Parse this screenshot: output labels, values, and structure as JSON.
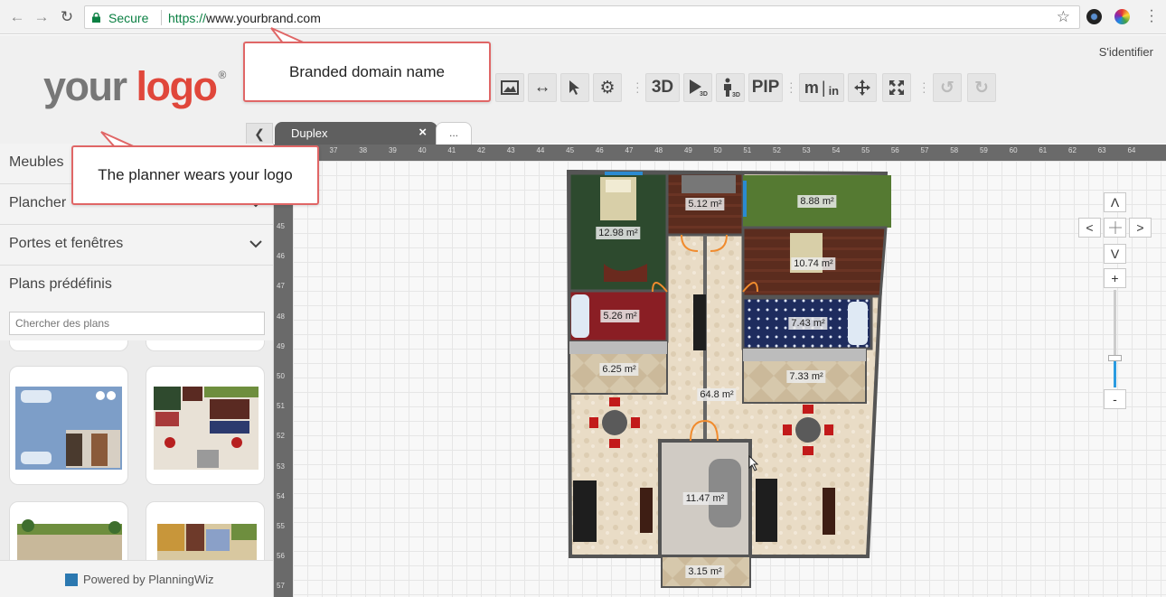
{
  "browser": {
    "secure_label": "Secure",
    "url_scheme": "https://",
    "url_host": "www.yourbrand.com"
  },
  "header": {
    "logo_your": "your",
    "logo_brand": "logo",
    "logo_reg": "®",
    "signin": "S'identifier",
    "logo_color": "#e0473b"
  },
  "toolbar": {
    "three_d": "3D",
    "pip": "PIP",
    "units_m": "m",
    "units_in": "in",
    "walk_sub": "3D",
    "play_sub": "3D"
  },
  "tabs": {
    "active": "Duplex",
    "close": "×",
    "more": "..."
  },
  "sidebar": {
    "items": [
      {
        "label": "Meubles"
      },
      {
        "label": "Plancher"
      },
      {
        "label": "Portes et fenêtres"
      },
      {
        "label": "Plans prédéfinis"
      }
    ],
    "search_placeholder": "Chercher des plans",
    "powered": "Powered by PlanningWiz"
  },
  "ruler": {
    "top": [
      "37",
      "38",
      "39",
      "40",
      "41",
      "42",
      "43",
      "44",
      "45",
      "46",
      "47",
      "48",
      "49",
      "50",
      "51",
      "52",
      "53",
      "54",
      "55",
      "56",
      "57",
      "58",
      "59",
      "60",
      "61",
      "62",
      "63",
      "64"
    ],
    "left": [
      "45",
      "46",
      "47",
      "48",
      "49",
      "50",
      "51",
      "52",
      "53",
      "54",
      "55",
      "56",
      "57"
    ]
  },
  "rooms": [
    {
      "label": "12.98 m²"
    },
    {
      "label": "5.12 m²"
    },
    {
      "label": "8.88 m²"
    },
    {
      "label": "10.74 m²"
    },
    {
      "label": "5.26 m²"
    },
    {
      "label": "7.43 m²"
    },
    {
      "label": "6.25 m²"
    },
    {
      "label": "7.33 m²"
    },
    {
      "label": "64.8 m²"
    },
    {
      "label": "11.47 m²"
    },
    {
      "label": "3.15 m²"
    }
  ],
  "navpad": {
    "up": "Λ",
    "left": "<",
    "right": ">",
    "down": "V",
    "zoom_in": "+",
    "zoom_out": "-",
    "zoom_level": 0.3
  },
  "callouts": {
    "domain": "Branded domain name",
    "logo": "The planner wears your logo"
  }
}
